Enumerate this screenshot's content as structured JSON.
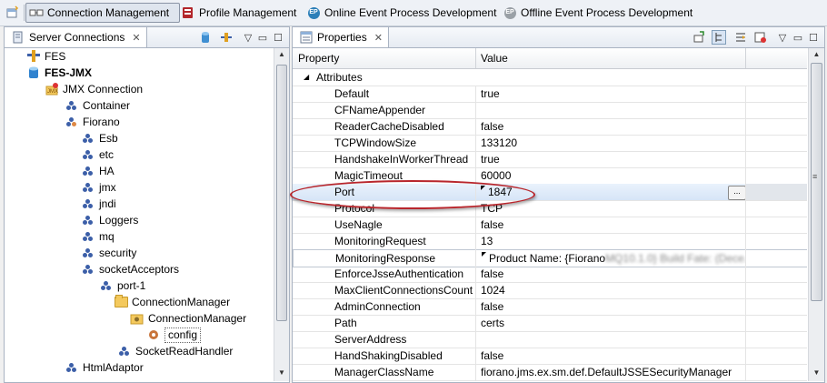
{
  "toolbar": {
    "perspectives": [
      {
        "label": "Connection Management",
        "icon": "connection-management-icon",
        "active": true
      },
      {
        "label": "Profile Management",
        "icon": "profile-management-icon",
        "active": false
      },
      {
        "label": "Online Event Process Development",
        "icon": "online-ep-icon",
        "active": false
      },
      {
        "label": "Offline Event Process Development",
        "icon": "offline-ep-icon",
        "active": false
      }
    ],
    "ep_badge": "EP"
  },
  "server_panel": {
    "tab_label": "Server Connections",
    "tree": [
      {
        "label": "FES",
        "icon": "server-icon",
        "bold": false
      },
      {
        "label": "FES-JMX",
        "icon": "database-icon",
        "bold": true
      },
      {
        "label": "JMX Connection",
        "icon": "jmx-connection-icon"
      },
      {
        "label": "Container",
        "icon": "node-icon"
      },
      {
        "label": "Fiorano",
        "icon": "node-icon"
      },
      {
        "label": "Esb",
        "icon": "node-icon"
      },
      {
        "label": "etc",
        "icon": "node-icon"
      },
      {
        "label": "HA",
        "icon": "node-icon"
      },
      {
        "label": "jmx",
        "icon": "node-icon"
      },
      {
        "label": "jndi",
        "icon": "node-icon"
      },
      {
        "label": "Loggers",
        "icon": "node-icon"
      },
      {
        "label": "mq",
        "icon": "node-icon"
      },
      {
        "label": "security",
        "icon": "node-icon"
      },
      {
        "label": "socketAcceptors",
        "icon": "node-icon"
      },
      {
        "label": "port-1",
        "icon": "node-icon"
      },
      {
        "label": "ConnectionManager",
        "icon": "folder-icon"
      },
      {
        "label": "ConnectionManager",
        "icon": "folder-gear-icon"
      },
      {
        "label": "config",
        "icon": "config-icon",
        "selected": true
      },
      {
        "label": "SocketReadHandler",
        "icon": "node-icon"
      },
      {
        "label": "HtmlAdaptor",
        "icon": "node-icon"
      }
    ]
  },
  "properties_panel": {
    "tab_label": "Properties",
    "col_property": "Property",
    "col_value": "Value",
    "group_label": "Attributes",
    "rows": [
      {
        "name": "Default",
        "value": "true"
      },
      {
        "name": "CFNameAppender",
        "value": ""
      },
      {
        "name": "ReaderCacheDisabled",
        "value": "false"
      },
      {
        "name": "TCPWindowSize",
        "value": "133120"
      },
      {
        "name": "HandshakeInWorkerThread",
        "value": "true"
      },
      {
        "name": "MagicTimeout",
        "value": "60000"
      },
      {
        "name": "Port",
        "value": "1847",
        "highlight": true
      },
      {
        "name": "Protocol",
        "value": "TCP"
      },
      {
        "name": "UseNagle",
        "value": "false"
      },
      {
        "name": "MonitoringRequest",
        "value": "13"
      },
      {
        "name": "MonitoringResponse",
        "value": "Product Name: {Fiorano",
        "value_blurred": "MQ10.1.0} Build Fate: (Dece...",
        "edited": true
      },
      {
        "name": "EnforceJsseAuthentication",
        "value": "false"
      },
      {
        "name": "MaxClientConnectionsCount",
        "value": "1024"
      },
      {
        "name": "AdminConnection",
        "value": "false"
      },
      {
        "name": "Path",
        "value": "certs"
      },
      {
        "name": "ServerAddress",
        "value": ""
      },
      {
        "name": "HandShakingDisabled",
        "value": "false"
      },
      {
        "name": "ManagerClassName",
        "value": "fiorano.jms.ex.sm.def.DefaultJSSESecurityManager"
      }
    ],
    "ellipsis_label": "..."
  }
}
